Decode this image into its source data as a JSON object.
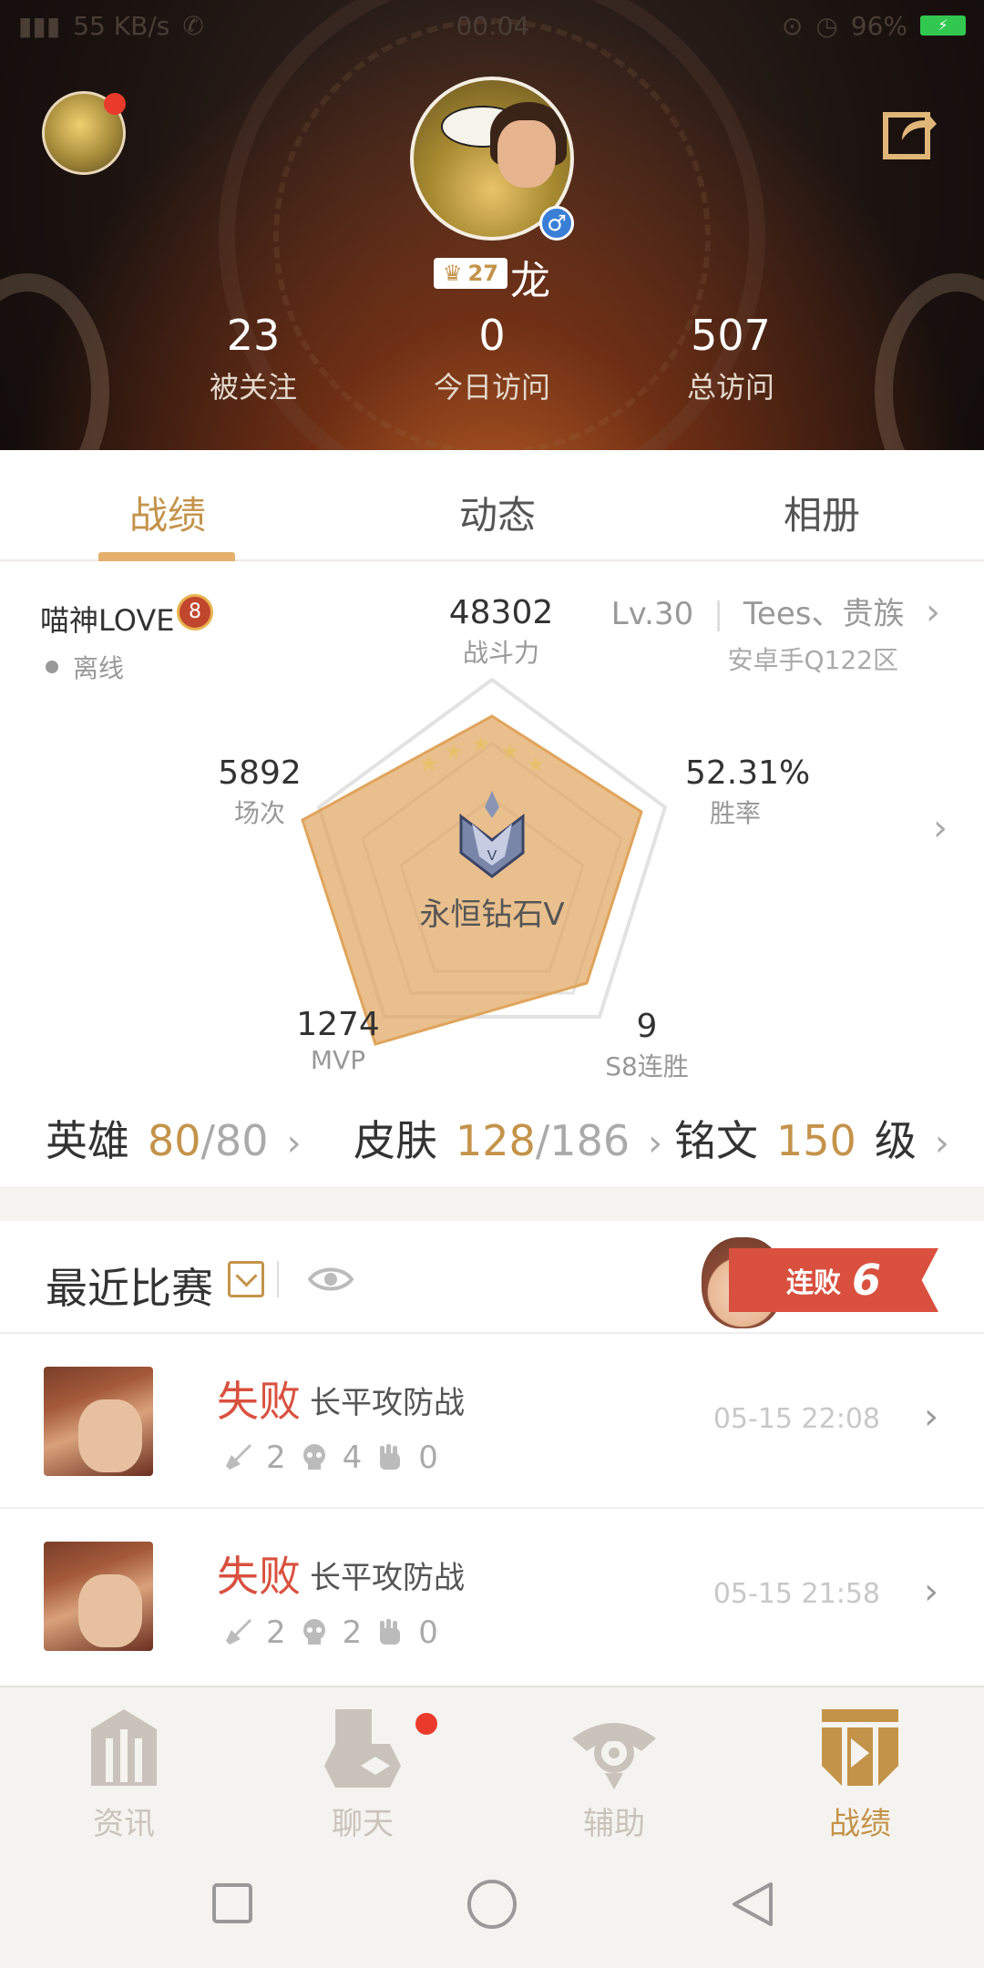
{
  "status_bar": {
    "network": "55 KB/s",
    "time": "00:04",
    "battery": "96%"
  },
  "profile": {
    "level": "27",
    "name": "龙",
    "stats": [
      {
        "value": "23",
        "label": "被关注"
      },
      {
        "value": "0",
        "label": "今日访问"
      },
      {
        "value": "507",
        "label": "总访问"
      }
    ]
  },
  "tabs": [
    {
      "label": "战绩",
      "active": true
    },
    {
      "label": "动态",
      "active": false
    },
    {
      "label": "相册",
      "active": false
    }
  ],
  "player": {
    "name": "喵神LOVE",
    "badge_level": "8",
    "status": "离线",
    "level": "Lv.30",
    "guild": "Tees、贵族",
    "server": "安卓手Q122区"
  },
  "radar": {
    "power": {
      "value": "48302",
      "label": "战斗力"
    },
    "matches": {
      "value": "5892",
      "label": "场次"
    },
    "win_rate": {
      "value": "52.31%",
      "label": "胜率"
    },
    "mvp": {
      "value": "1274",
      "label": "MVP"
    },
    "streak": {
      "value": "9",
      "label": "S8连胜"
    },
    "rank": "永恒钻石V"
  },
  "collection": {
    "heroes": {
      "label": "英雄",
      "owned": "80",
      "total": "/80"
    },
    "skins": {
      "label": "皮肤",
      "owned": "128",
      "total": "/186"
    },
    "runes": {
      "label": "铭文",
      "owned": "150",
      "unit": "级"
    }
  },
  "recent": {
    "title": "最近比赛",
    "streak_label": "连败",
    "streak_count": "6",
    "matches": [
      {
        "result": "失败",
        "mode": "长平攻防战",
        "kills": "2",
        "deaths": "4",
        "assists": "0",
        "time": "05-15 22:08"
      },
      {
        "result": "失败",
        "mode": "长平攻防战",
        "kills": "2",
        "deaths": "2",
        "assists": "0",
        "time": "05-15 21:58"
      }
    ]
  },
  "bottom_nav": [
    {
      "label": "资讯",
      "active": false
    },
    {
      "label": "聊天",
      "active": false
    },
    {
      "label": "辅助",
      "active": false
    },
    {
      "label": "战绩",
      "active": true
    }
  ],
  "colors": {
    "accent": "#c4934a",
    "loss_red": "#d9503e",
    "notification": "#ea3a2b"
  }
}
